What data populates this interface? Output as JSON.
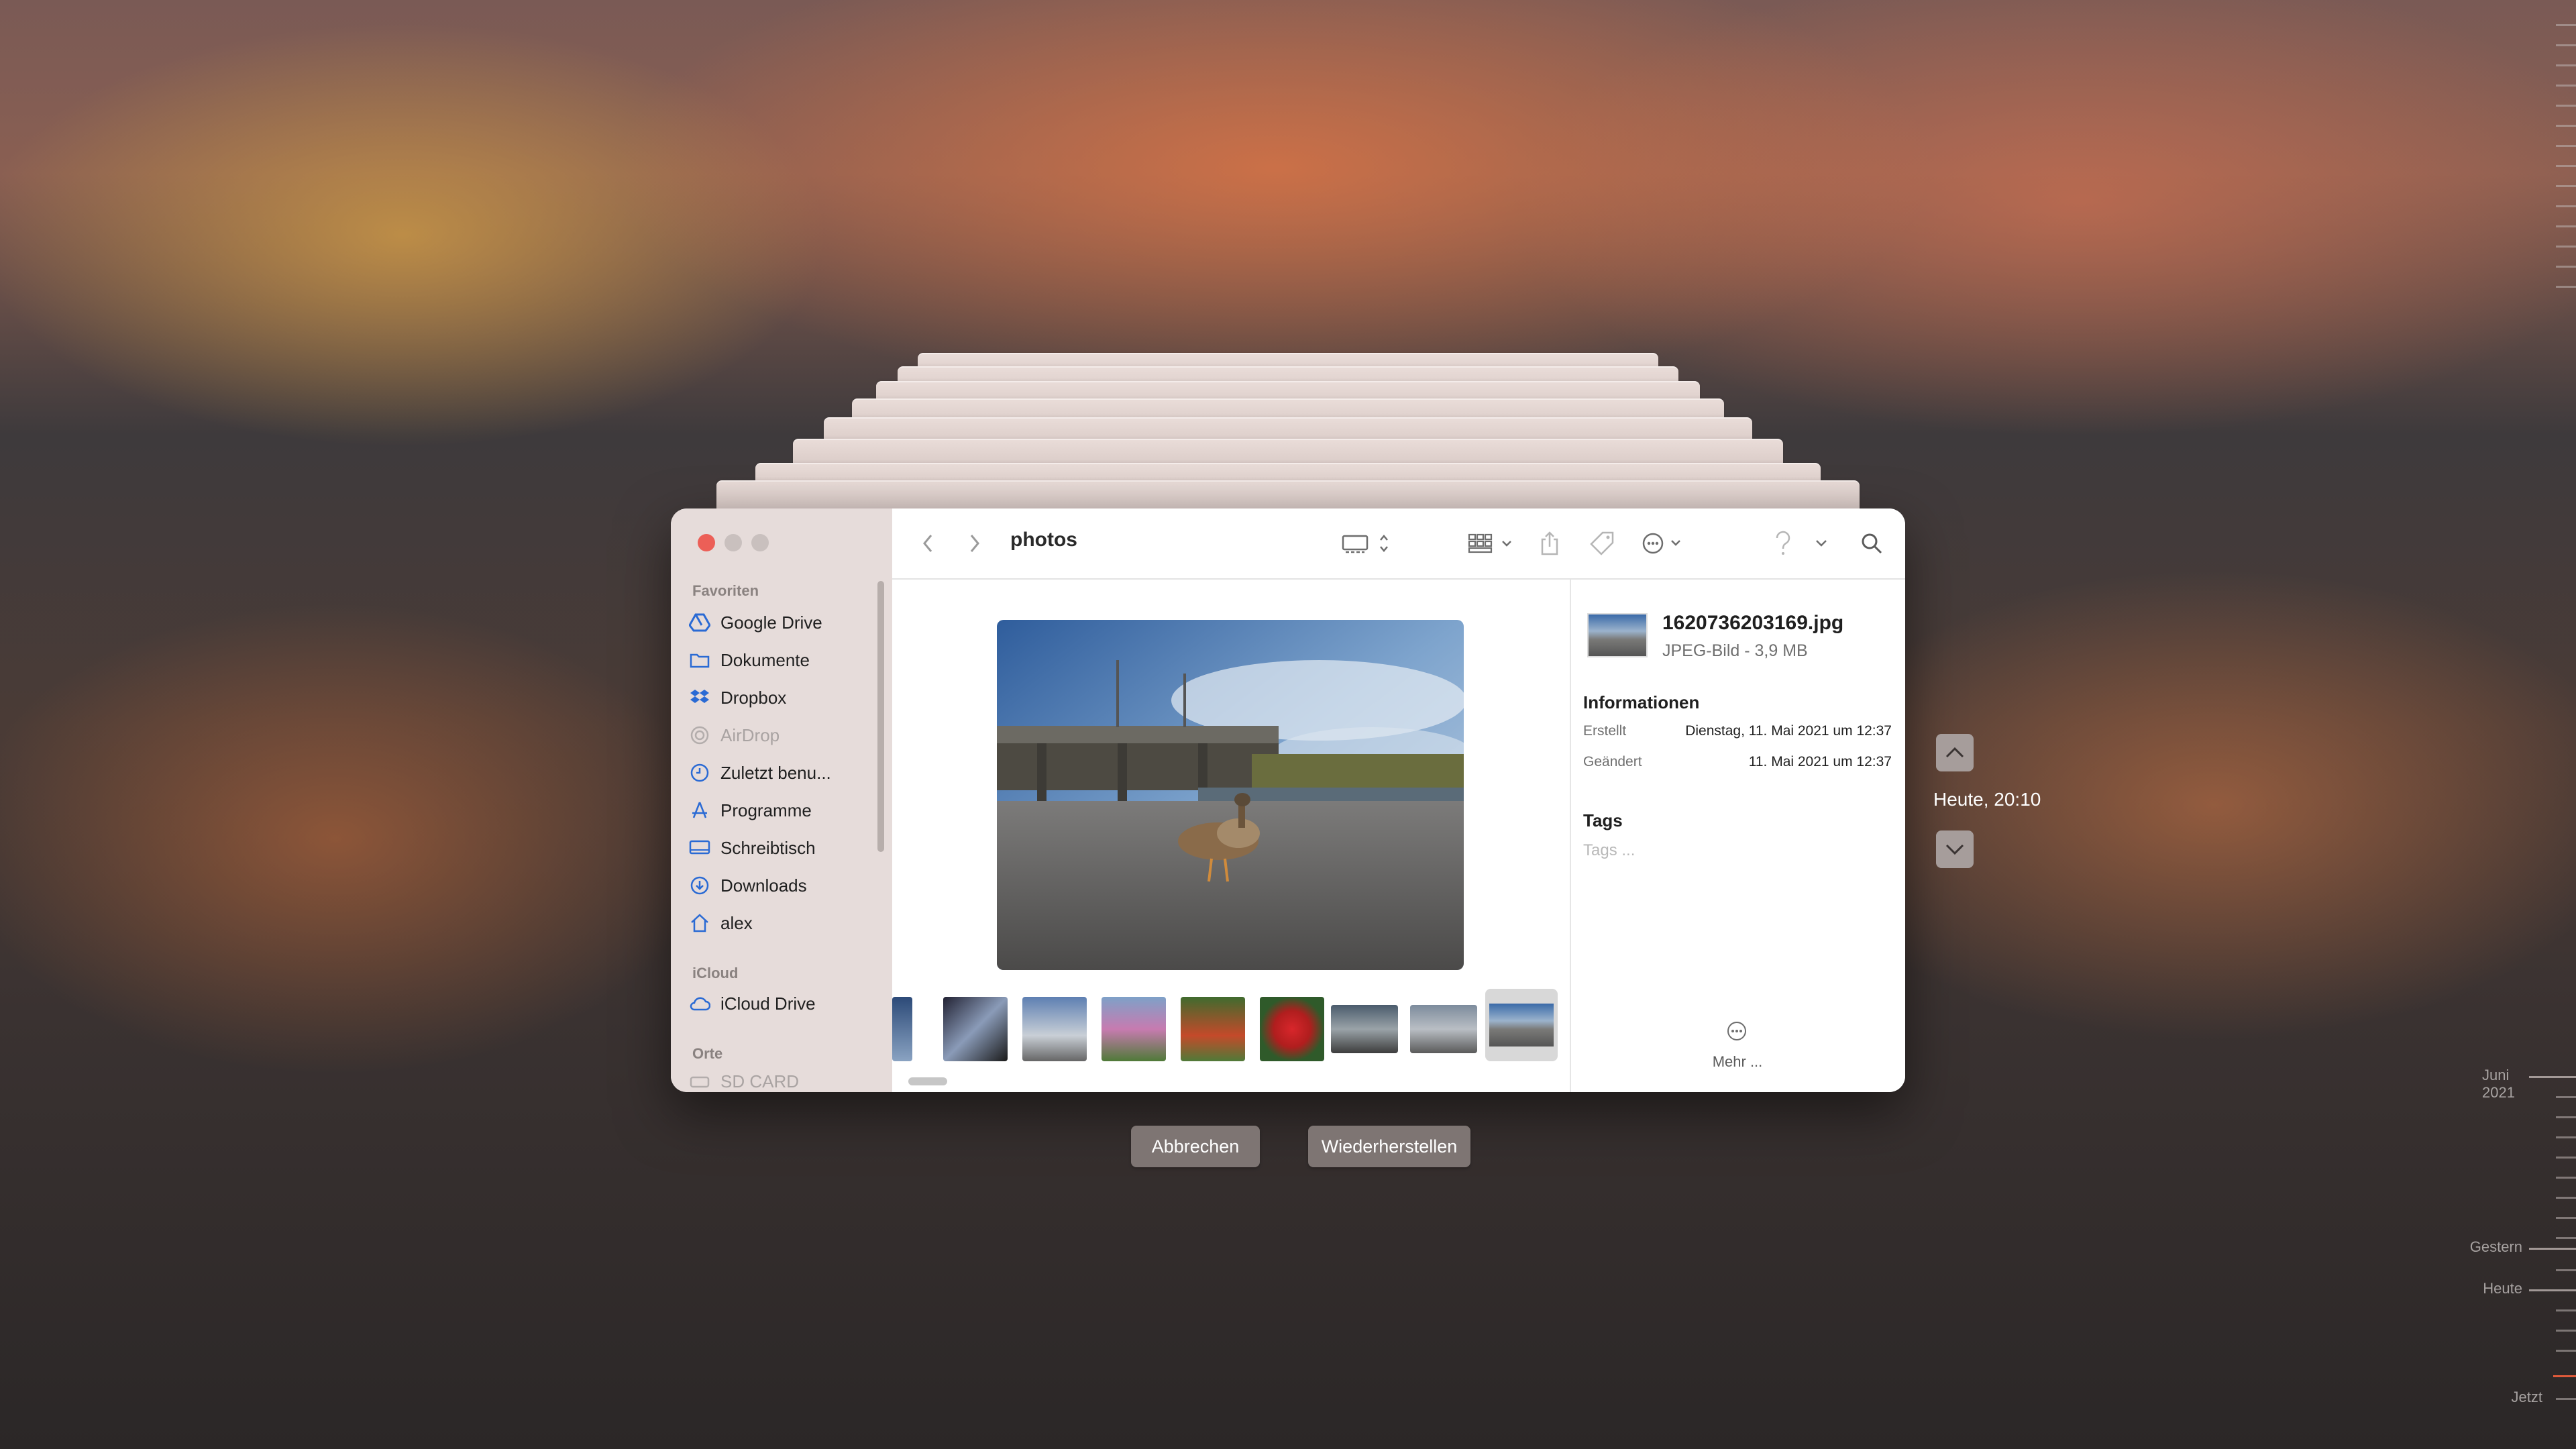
{
  "window": {
    "title": "photos"
  },
  "sidebar": {
    "favorites_label": "Favoriten",
    "favorites": [
      {
        "label": "Google Drive",
        "icon": "google-drive-icon"
      },
      {
        "label": "Dokumente",
        "icon": "folder-icon"
      },
      {
        "label": "Dropbox",
        "icon": "dropbox-icon"
      },
      {
        "label": "AirDrop",
        "icon": "airdrop-icon"
      },
      {
        "label": "Zuletzt benu...",
        "icon": "clock-icon"
      },
      {
        "label": "Programme",
        "icon": "apps-icon"
      },
      {
        "label": "Schreibtisch",
        "icon": "desktop-icon"
      },
      {
        "label": "Downloads",
        "icon": "download-icon"
      },
      {
        "label": "alex",
        "icon": "home-icon"
      }
    ],
    "icloud_label": "iCloud",
    "icloud": [
      {
        "label": "iCloud Drive",
        "icon": "cloud-icon"
      }
    ],
    "places_label": "Orte",
    "places": [
      {
        "label": "SD CARD",
        "icon": "drive-icon"
      }
    ]
  },
  "info_panel": {
    "file_name": "1620736203169.jpg",
    "file_type": "JPEG-Bild - 3,9 MB",
    "info_heading": "Informationen",
    "created_label": "Erstellt",
    "created_value": "Dienstag, 11. Mai 2021 um 12:37",
    "modified_label": "Geändert",
    "modified_value": "11. Mai 2021 um 12:37",
    "tags_heading": "Tags",
    "tags_placeholder": "Tags ...",
    "more_label": "Mehr ..."
  },
  "buttons": {
    "cancel": "Abbrechen",
    "restore": "Wiederherstellen"
  },
  "time_machine": {
    "current_label": "Heute, 20:10",
    "timeline": {
      "june": "Juni 2021",
      "yesterday": "Gestern",
      "today": "Heute",
      "now": "Jetzt"
    }
  },
  "colors": {
    "close": "#ec5f57",
    "minimize": "#c9c0be",
    "zoom": "#c9c0be",
    "sidebar_icon": "#2a6ad4",
    "selected_thumb_bg": "#d8d8d8",
    "timeline_now": "#e05a3a"
  }
}
